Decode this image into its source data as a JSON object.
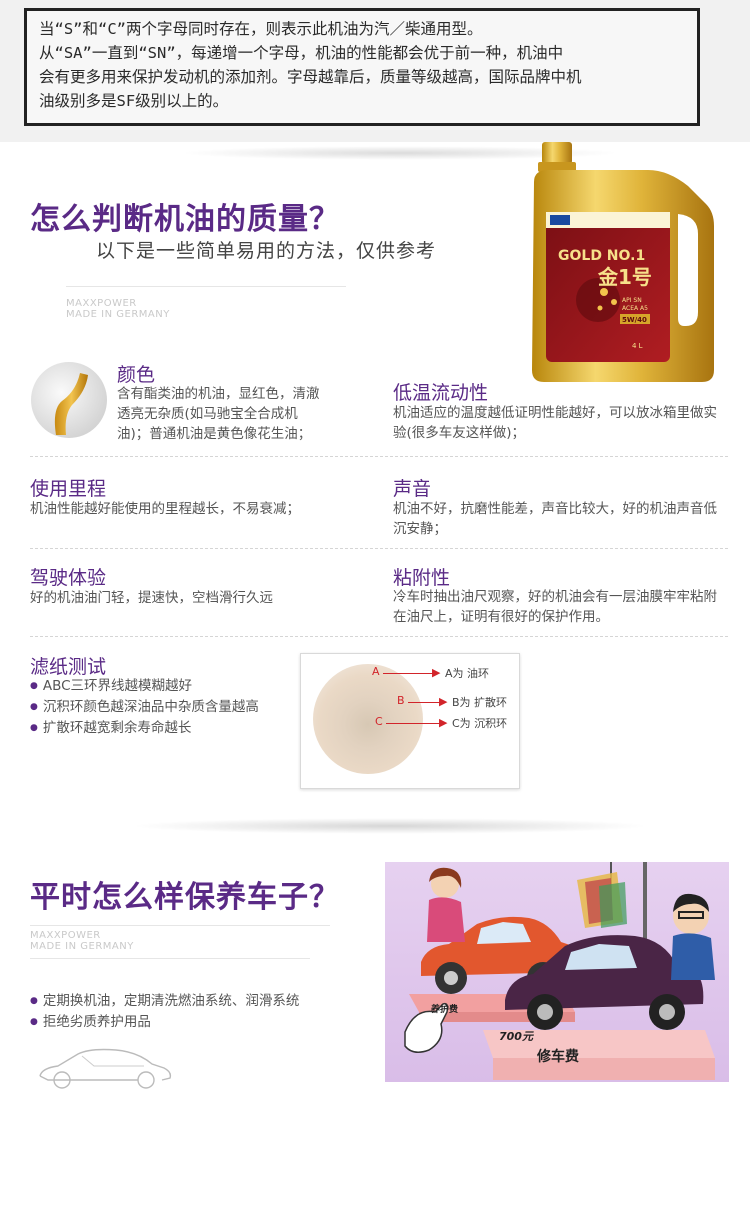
{
  "top_note": {
    "line1": "当“S”和“C”两个字母同时存在，则表示此机油为汽／柴通用型。",
    "line2": "从“SA”一直到“SN”，每递增一个字母，机油的性能都会优于前一种，机油中",
    "line3": "会有更多用来保护发动机的添加剂。字母越靠后，质量等级越高，国际品牌中机",
    "line4": "油级别多是SF级别以上的。"
  },
  "quality_section": {
    "title": "怎么判断机油的质量？",
    "subtitle": "以下是一些简单易用的方法，仅供参考",
    "faint_line1": "MAXXPOWER",
    "faint_line2": "MADE IN GERMANY"
  },
  "product": {
    "brand_line": "GOLD NO.1",
    "name_cn": "金1号",
    "spec1": "API SN",
    "spec2": "ACEA A5",
    "grade": "5W/40",
    "volume": "4 L"
  },
  "methods": [
    {
      "title": "颜色",
      "text": "含有酯类油的机油，显红色，清澈透亮无杂质(如马驰宝全合成机油)；普通机油是黄色像花生油；"
    },
    {
      "title": "低温流动性",
      "text": "机油适应的温度越低证明性能越好，可以放冰箱里做实验(很多车友这样做)；"
    },
    {
      "title": "使用里程",
      "text": "机油性能越好能使用的里程越长，不易衰减；"
    },
    {
      "title": "声音",
      "text": "机油不好，抗磨性能差，声音比较大，好的机油声音低沉安静；"
    },
    {
      "title": "驾驶体验",
      "text": "好的机油油门轻，提速快，空档滑行久远"
    },
    {
      "title": "粘附性",
      "text": "冷车时抽出油尺观察，好的机油会有一层油膜牢牢粘附在油尺上，证明有很好的保护作用。"
    }
  ],
  "filter_test": {
    "title": "滤纸测试",
    "bullets": [
      "ABC三环界线越模糊越好",
      "沉积环颜色越深油品中杂质含量越高",
      "扩散环越宽剩余寿命越长"
    ],
    "rings": [
      {
        "letter": "A",
        "label": "A为 油环"
      },
      {
        "letter": "B",
        "label": "B为 扩散环"
      },
      {
        "letter": "C",
        "label": "C为 沉积环"
      }
    ]
  },
  "maintenance_section": {
    "title": "平时怎么样保养车子？",
    "faint_line1": "MAXXPOWER",
    "faint_line2": "MADE IN GERMANY",
    "bullets": [
      "定期换机油，定期清洗燃油系统、润滑系统",
      "拒绝劣质养护用品"
    ],
    "cartoon_left_tag": "养护费",
    "cartoon_price": "700元",
    "cartoon_right_tag": "修车费"
  },
  "colors": {
    "accent_purple": "#5a2a86",
    "ring_red": "#d2242a",
    "gold": "#d9a520"
  }
}
